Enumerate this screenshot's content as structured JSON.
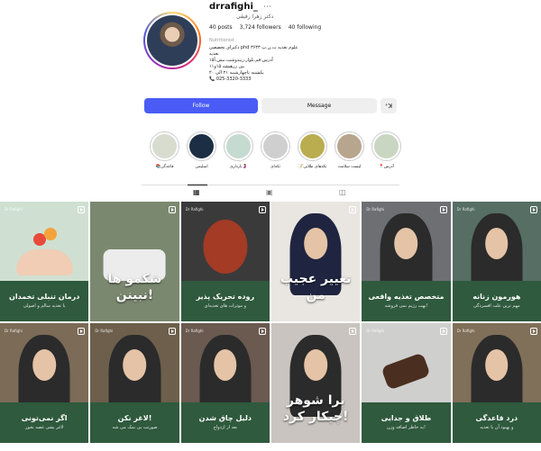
{
  "profile": {
    "username": "drrafighi_",
    "more_icon": "ellipsis-icon",
    "full_name": "دکتر زهرا رفیقی",
    "stats": {
      "posts": "40 posts",
      "followers": "3,724 followers",
      "following": "40 following"
    },
    "category": "Nutritionist",
    "bio_lines": [
      "دکترای تخصصی phd علوم تغذیه ت.ن.پ ۳۶۳۳",
      "تغذیه",
      "آدرس:قم.بلوار.زیندوشت.نبش.آ۱۵",
      "بین زرهیشه ۱۵و۱۱",
      "یکشنبه تاچهارشنبه ۲۱ الی ۲۰",
      "📞 025-3320-3333"
    ]
  },
  "actions": {
    "follow": "Follow",
    "message": "Message",
    "suggest_icon": "person-add-icon",
    "suggest": "⁺ꓘ"
  },
  "highlights": [
    {
      "label": "📚قاعدگی",
      "color": "#d7dccf"
    },
    {
      "label": "اسلیمی",
      "color": "#1c2e44"
    },
    {
      "label": "بارداری🤰",
      "color": "#c5dbd1"
    },
    {
      "label": "تکه‌ای",
      "color": "#cfcfcf"
    },
    {
      "label": "📝تکه‌های طلایی",
      "color": "#b9ad4f"
    },
    {
      "label": "لیست سلامت",
      "color": "#b8a58d"
    },
    {
      "label": "📍آدرس",
      "color": "#c9d6c2"
    }
  ],
  "tabs": [
    {
      "name": "posts-tab-icon",
      "glyph": "▦"
    },
    {
      "name": "reels-tab-icon",
      "glyph": "▣"
    },
    {
      "name": "tagged-tab-icon",
      "glyph": "◫"
    }
  ],
  "grid": [
    {
      "type": "caption",
      "bg": "#cfe0d3",
      "title": "درمان تنبلی تخمدان",
      "sub": "با تغذیه سالم و اصولی",
      "style": "hands",
      "dr": "Dr Rafighi"
    },
    {
      "type": "big",
      "bg": "#7b8870",
      "title": "شکمو ها نبینن!",
      "style": "street",
      "dr": ""
    },
    {
      "type": "caption",
      "bg": "#3a3a3a",
      "title": "روده تحریک پذیر",
      "sub": "و موثرات های تغذیه‌ای",
      "style": "gut",
      "dr": "Dr Rafighi"
    },
    {
      "type": "big",
      "bg": "#e9e6e1",
      "title": "تغییر عجیب من",
      "style": "selfie",
      "dr": ""
    },
    {
      "type": "caption",
      "bg": "#6e6f73",
      "title": "متخصص تغذیه واقعی",
      "sub": "بهت رژیم نمی فروشه!",
      "style": "person",
      "dr": "Dr Rafighi"
    },
    {
      "type": "caption",
      "bg": "#566e64",
      "title": "هورمون زنانه",
      "sub": "مهم ترین علت افسردگی",
      "style": "person",
      "dr": "Dr Rafighi"
    },
    {
      "type": "caption",
      "bg": "#7b6b57",
      "title": "اگر نمی‌تونی",
      "sub": "لاغر بشی غصه نخور",
      "style": "person",
      "dr": "Dr Rafighi"
    },
    {
      "type": "caption",
      "bg": "#6d5f4b",
      "title": "لاغر نکن!",
      "sub": "صورتت بی نمک می شه",
      "style": "person",
      "dr": "Dr Rafighi"
    },
    {
      "type": "caption",
      "bg": "#6a5a4f",
      "title": "دلیل چاق شدن",
      "sub": "بعد از ازدواج",
      "style": "person",
      "dr": "Dr Rafighi"
    },
    {
      "type": "big",
      "bg": "#c9c4bf",
      "title": "برا شوهر چیکار کرد!",
      "style": "couple",
      "dr": ""
    },
    {
      "type": "caption",
      "bg": "#cfcfcd",
      "title": "طلاق و جدایی",
      "sub": "به خاطر اضافه وزن!",
      "style": "gavel",
      "dr": "Dr Rafighi"
    },
    {
      "type": "caption",
      "bg": "#806f59",
      "title": "درد قاعدگی",
      "sub": "و بهبود آن با تغذیه",
      "style": "person",
      "dr": "Dr Rafighi"
    }
  ]
}
